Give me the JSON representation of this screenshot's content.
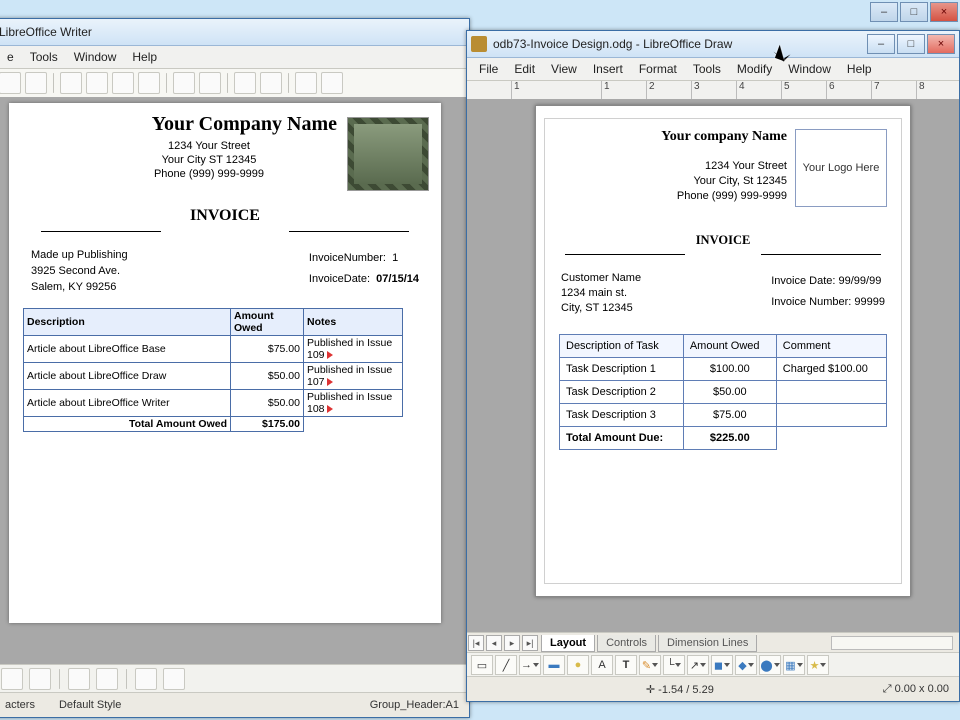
{
  "writer": {
    "title": "LibreOffice Writer",
    "menus": [
      "e",
      "Tools",
      "Window",
      "Help"
    ],
    "company": "Your Company Name",
    "addr1": "1234 Your Street",
    "addr2": "Your City ST 12345",
    "addr3": "Phone (999) 999-9999",
    "invoice_label": "INVOICE",
    "cust1": "Made up Publishing",
    "cust2": "3925 Second Ave.",
    "cust3": "Salem, KY 99256",
    "inv_num_label": "InvoiceNumber:",
    "inv_num": "1",
    "inv_date_label": "InvoiceDate:",
    "inv_date": "07/15/14",
    "cols": {
      "desc": "Description",
      "amt": "Amount Owed",
      "notes": "Notes"
    },
    "rows": [
      {
        "desc": "Article about LibreOffice Base",
        "amt": "$75.00",
        "notes": "Published in Issue 109"
      },
      {
        "desc": "Article about LibreOffice Draw",
        "amt": "$50.00",
        "notes": "Published in Issue 107"
      },
      {
        "desc": "Article about LibreOffice Writer",
        "amt": "$50.00",
        "notes": "Published in Issue 108"
      }
    ],
    "total_label": "Total Amount Owed",
    "total": "$175.00",
    "status_left": "acters",
    "status_style": "Default Style",
    "status_right": "Group_Header:A1"
  },
  "draw": {
    "title": "odb73-Invoice Design.odg - LibreOffice Draw",
    "menus": [
      "File",
      "Edit",
      "View",
      "Insert",
      "Format",
      "Tools",
      "Modify",
      "Window",
      "Help"
    ],
    "ruler": [
      "1",
      "1",
      "2",
      "3",
      "4",
      "5",
      "6",
      "7",
      "8"
    ],
    "company": "Your company Name",
    "addr1": "1234 Your Street",
    "addr2": "Your City, St 12345",
    "addr3": "Phone (999) 999-9999",
    "logo": "Your Logo Here",
    "invoice_label": "INVOICE",
    "cust1": "Customer Name",
    "cust2": "1234 main st.",
    "cust3": "City, ST 12345",
    "inv_date_label": "Invoice Date:",
    "inv_date": "99/99/99",
    "inv_num_label": "Invoice Number:",
    "inv_num": "99999",
    "cols": {
      "desc": "Description of Task",
      "amt": "Amount Owed",
      "comment": "Comment"
    },
    "rows": [
      {
        "desc": "Task Description 1",
        "amt": "$100.00",
        "comment": "Charged $100.00"
      },
      {
        "desc": "Task Description 2",
        "amt": "$50.00",
        "comment": ""
      },
      {
        "desc": "Task Description 3",
        "amt": "$75.00",
        "comment": ""
      }
    ],
    "total_label": "Total Amount Due:",
    "total": "$225.00",
    "tabs": [
      "Layout",
      "Controls",
      "Dimension Lines"
    ],
    "status_pos": "-1.54 / 5.29",
    "status_size": "0.00 x 0.00"
  }
}
